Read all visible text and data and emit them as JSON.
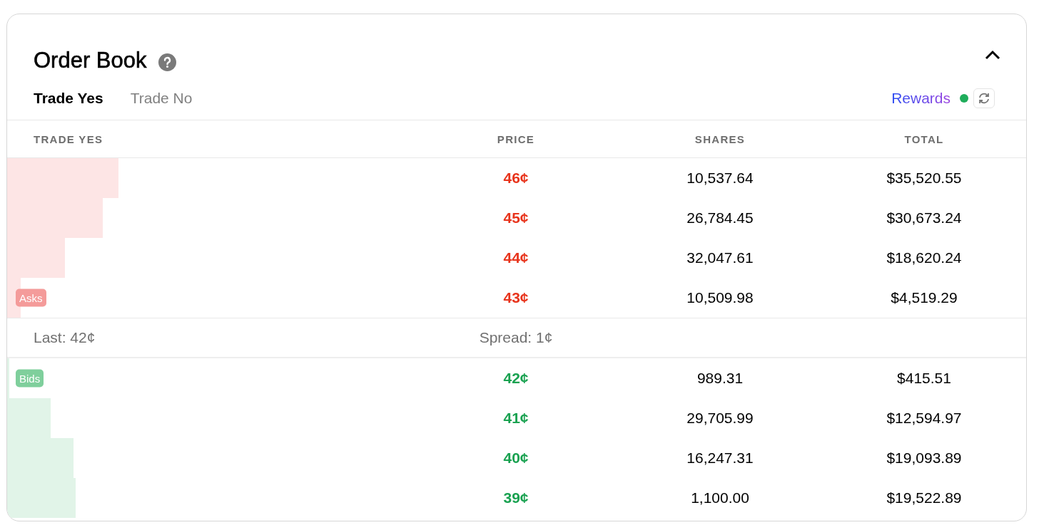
{
  "title": "Order Book",
  "tabs": [
    {
      "label": "Trade Yes",
      "selected": true
    },
    {
      "label": "Trade No",
      "selected": false
    }
  ],
  "rewards": {
    "label": "Rewards",
    "active": true
  },
  "columns": [
    "TRADE YES",
    "PRICE",
    "SHARES",
    "TOTAL"
  ],
  "asks": {
    "kind": "asks",
    "label": "Asks",
    "rows": [
      {
        "price": "46¢",
        "shares": "10,537.64",
        "total": "$35,520.55",
        "level": 0.109
      },
      {
        "price": "45¢",
        "shares": "26,784.45",
        "total": "$30,673.24",
        "level": 0.094
      },
      {
        "price": "44¢",
        "shares": "32,047.61",
        "total": "$18,620.24",
        "level": 0.057
      },
      {
        "price": "43¢",
        "shares": "10,509.98",
        "total": "$4,519.29",
        "level": 0.013
      }
    ]
  },
  "summary": {
    "last": "Last: 42¢",
    "spread": "Spread: 1¢"
  },
  "bids": {
    "kind": "bids",
    "label": "Bids",
    "rows": [
      {
        "price": "42¢",
        "shares": "989.31",
        "total": "$415.51",
        "level": 0.002
      },
      {
        "price": "41¢",
        "shares": "29,705.99",
        "total": "$12,594.97",
        "level": 0.043
      },
      {
        "price": "40¢",
        "shares": "16,247.31",
        "total": "$19,093.89",
        "level": 0.065
      },
      {
        "price": "39¢",
        "shares": "1,100.00",
        "total": "$19,522.89",
        "level": 0.067
      }
    ]
  }
}
